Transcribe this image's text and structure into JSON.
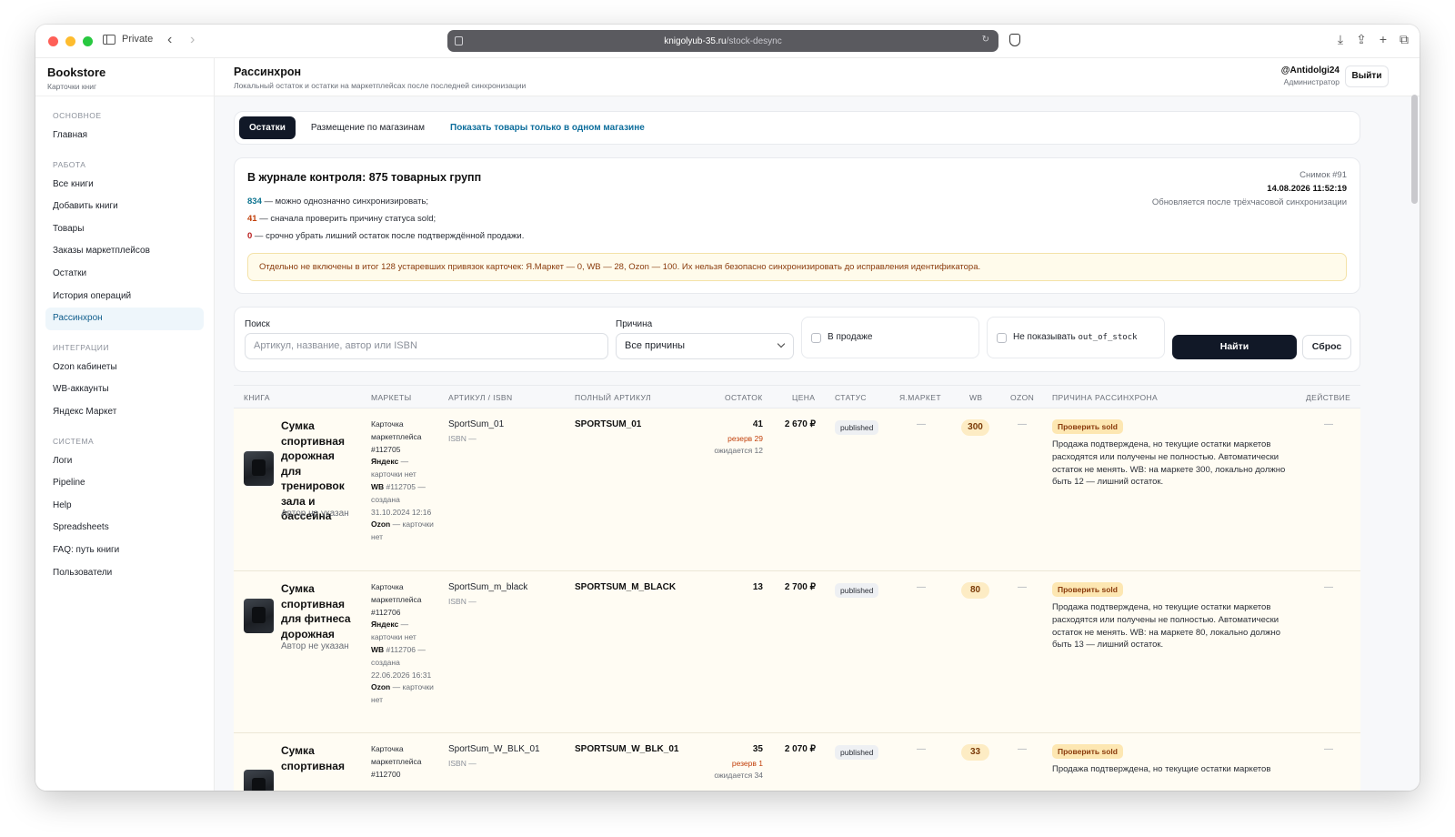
{
  "browser": {
    "private_label": "Private",
    "url_host": "knigolyub-35.ru",
    "url_path": "/stock-desync"
  },
  "sidebar": {
    "brand_title": "Bookstore",
    "brand_sub": "Карточки книг",
    "sections": {
      "main": "Основное",
      "work": "Работа",
      "integrations": "Интеграции",
      "system": "Система"
    },
    "items": {
      "home": "Главная",
      "all_books": "Все книги",
      "add_books": "Добавить книги",
      "products": "Товары",
      "orders": "Заказы маркетплейсов",
      "stock": "Остатки",
      "history": "История операций",
      "desync": "Рассинхрон",
      "ozon": "Ozon кабинеты",
      "wb": "WB-аккаунты",
      "yandex": "Яндекс Маркет",
      "logs": "Логи",
      "pipeline": "Pipeline",
      "help": "Help",
      "spreadsheets": "Spreadsheets",
      "faq": "FAQ: путь книги",
      "users": "Пользователи"
    }
  },
  "header": {
    "title": "Рассинхрон",
    "subtitle": "Локальный остаток и остатки на маркетплейсах после последней синхронизации",
    "user_name": "@Antidolgi24",
    "user_role": "Администратор",
    "logout": "Выйти"
  },
  "tabs": {
    "stock": "Остатки",
    "placement": "Размещение по магазинам",
    "single_store": "Показать товары только в одном магазине"
  },
  "summary": {
    "title": "В журнале контроля: 875 товарных групп",
    "sync_count": "834",
    "sync_text": " — можно однозначно синхронизировать;",
    "check_count": "41",
    "check_text": " — сначала проверить причину статуса sold;",
    "urgent_count": "0",
    "urgent_text": " — срочно убрать лишний остаток после подтверждённой продажи.",
    "snapshot": "Снимок #91",
    "snapshot_date": "14.08.2026 11:52:19",
    "snapshot_note": "Обновляется после трёхчасовой синхронизации",
    "warning": "Отдельно не включены в итог 128 устаревших привязок карточек: Я.Маркет — 0, WB — 28, Ozon — 100. Их нельзя безопасно синхронизировать до исправления идентификатора."
  },
  "filters": {
    "search_label": "Поиск",
    "search_placeholder": "Артикул, название, автор или ISBN",
    "reason_label": "Причина",
    "reason_value": "Все причины",
    "on_sale": "В продаже",
    "hide_prefix": "Не показывать ",
    "hide_code": "out_of_stock",
    "find": "Найти",
    "reset": "Сброс"
  },
  "table": {
    "headers": {
      "book": "Книга",
      "markets": "Маркеты",
      "article": "Артикул / ISBN",
      "full_article": "Полный артикул",
      "stock": "Остаток",
      "price": "Цена",
      "status": "Статус",
      "ymarket": "Я.Маркет",
      "wb": "WB",
      "ozon": "Ozon",
      "reason": "Причина рассинхрона",
      "action": "Действие"
    },
    "rows": [
      {
        "title": "Сумка спортивная дорожная для тренировок зала и бассейна",
        "author": "Автор не указан",
        "m_card": "Карточка маркетплейса #112705",
        "m_yandex_label": "Яндекс",
        "m_yandex": " — карточки нет",
        "m_wb_label": "WB",
        "m_wb": " #112705 — создана 31.10.2024 12:16",
        "m_ozon_label": "Ozon",
        "m_ozon": " — карточки нет",
        "article": "SportSum_01",
        "isbn": "ISBN —",
        "full_article": "SPORTSUM_01",
        "stock": "41",
        "reserve": "резерв 29",
        "expected": "ожидается 12",
        "price": "2 670 ₽",
        "status": "published",
        "ymarket": "—",
        "wb": "300",
        "ozon": "—",
        "reason_tag": "Проверить sold",
        "reason": "Продажа подтверждена, но текущие остатки маркетов расходятся или получены не полностью. Автоматически остаток не менять. WB: на маркете 300, локально должно быть 12 — лишний остаток.",
        "action": "—"
      },
      {
        "title": "Сумка спортивная для фитнеса дорожная",
        "author": "Автор не указан",
        "m_card": "Карточка маркетплейса #112706",
        "m_yandex_label": "Яндекс",
        "m_yandex": " — карточки нет",
        "m_wb_label": "WB",
        "m_wb": " #112706 — создана 22.06.2026 16:31",
        "m_ozon_label": "Ozon",
        "m_ozon": " — карточки нет",
        "article": "SportSum_m_black",
        "isbn": "ISBN —",
        "full_article": "SPORTSUM_M_BLACK",
        "stock": "13",
        "price": "2 700 ₽",
        "status": "published",
        "ymarket": "—",
        "wb": "80",
        "ozon": "—",
        "reason_tag": "Проверить sold",
        "reason": "Продажа подтверждена, но текущие остатки маркетов расходятся или получены не полностью. Автоматически остаток не менять. WB: на маркете 80, локально должно быть 13 — лишний остаток.",
        "action": "—"
      },
      {
        "title": "Сумка спортивная",
        "m_card": "Карточка маркетплейса #112700",
        "article": "SportSum_W_BLK_01",
        "isbn": "ISBN —",
        "full_article": "SPORTSUM_W_BLK_01",
        "stock": "35",
        "reserve": "резерв 1",
        "expected": "ожидается 34",
        "price": "2 070 ₽",
        "status": "published",
        "ymarket": "—",
        "wb": "33",
        "ozon": "—",
        "reason_tag": "Проверить sold",
        "reason": "Продажа подтверждена, но текущие остатки маркетов",
        "action": "—"
      }
    ]
  }
}
